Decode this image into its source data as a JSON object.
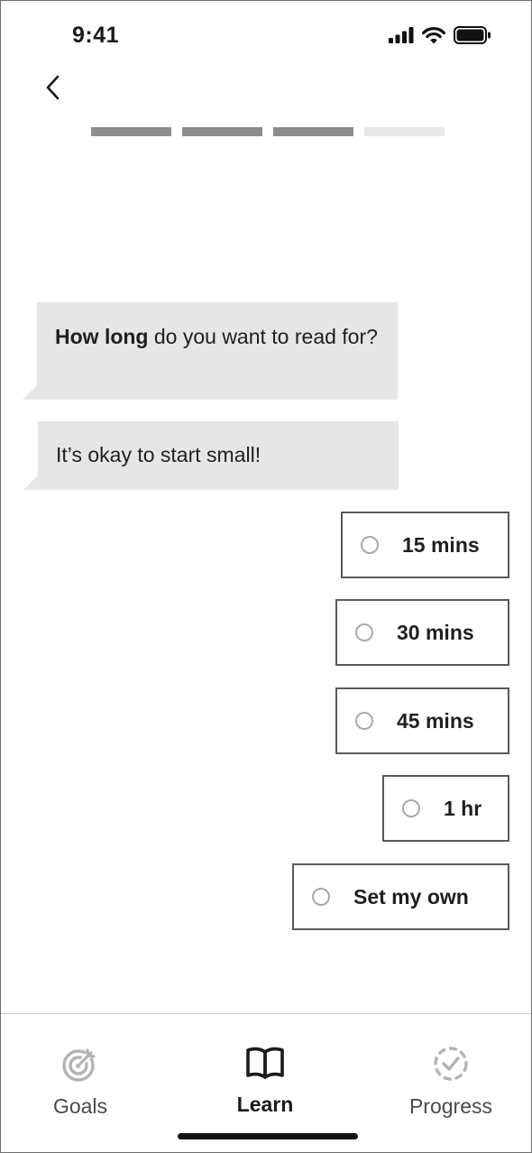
{
  "status_bar": {
    "time": "9:41"
  },
  "progress": {
    "total_steps": 4,
    "completed_steps": 3
  },
  "chat": {
    "question_bold": "How long",
    "question_rest": " do you want to read for?",
    "encouragement": "It’s okay to start small!"
  },
  "options": [
    {
      "label": "15 mins"
    },
    {
      "label": "30 mins"
    },
    {
      "label": "45 mins"
    },
    {
      "label": "1 hr"
    },
    {
      "label": "Set my own"
    }
  ],
  "tabs": {
    "goals": "Goals",
    "learn": "Learn",
    "progress": "Progress",
    "active": "learn"
  },
  "icons": [
    "signal-icon",
    "wifi-icon",
    "battery-icon",
    "back-chevron-icon",
    "target-icon",
    "book-icon",
    "check-circle-icon"
  ]
}
